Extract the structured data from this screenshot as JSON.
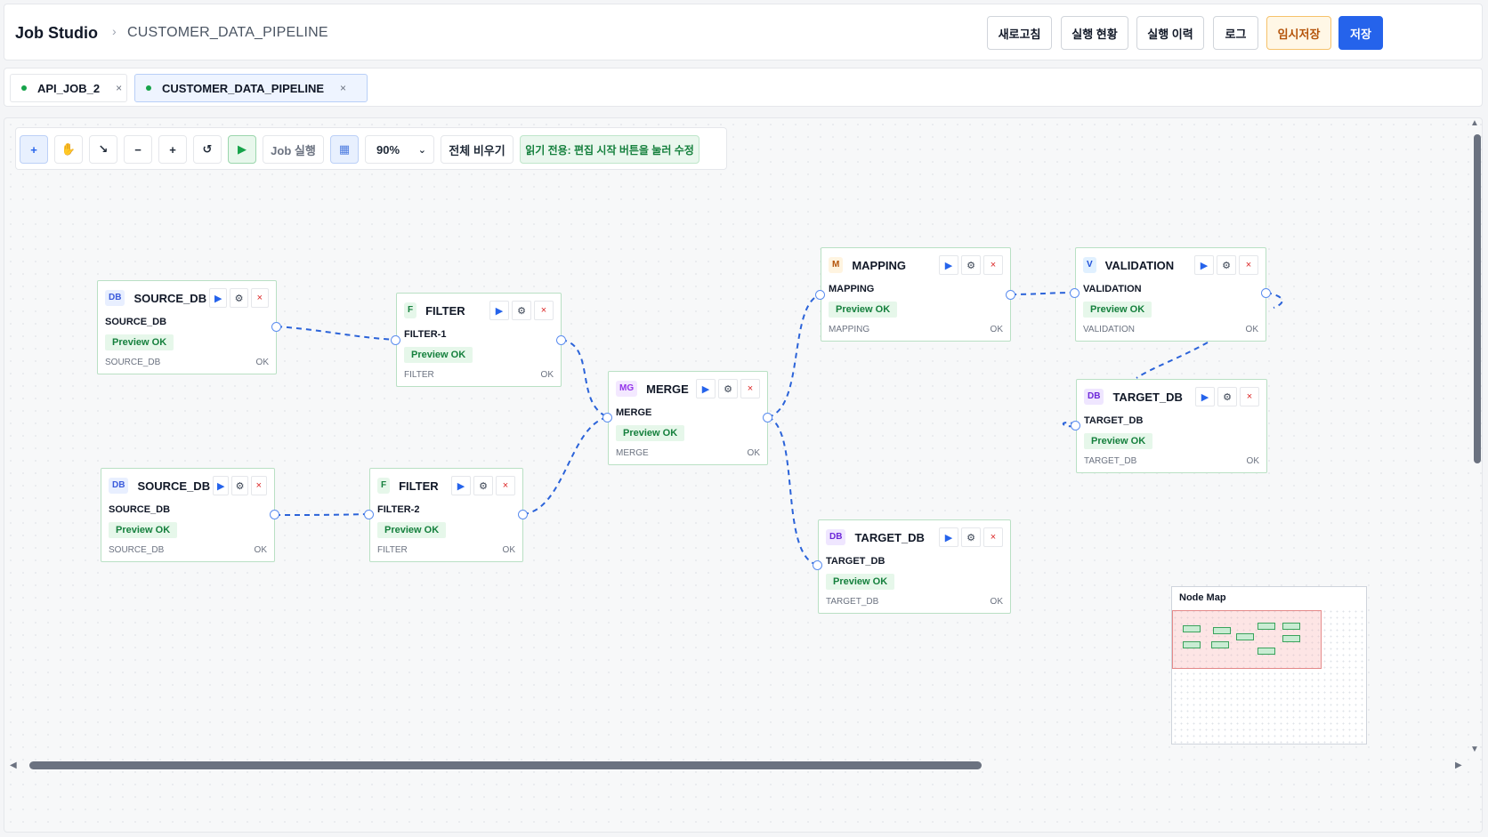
{
  "header": {
    "app_title": "Job Studio",
    "separator": "›",
    "current_job": "CUSTOMER_DATA_PIPELINE",
    "buttons": {
      "refresh": "새로고침",
      "exec_status": "실행 현황",
      "exec_history": "실행 이력",
      "log": "로그",
      "temp_save": "임시저장",
      "save": "저장"
    }
  },
  "tabs": [
    {
      "label": "API_JOB_2",
      "close": "×"
    },
    {
      "label": "CUSTOMER_DATA_PIPELINE",
      "close": "×"
    }
  ],
  "toolbar": {
    "select_icon": "+",
    "hand_icon": "✋",
    "edge_icon": "↘",
    "zoom_out": "−",
    "zoom_in": "+",
    "reset": "↺",
    "run_icon": "▶",
    "job_run": "Job 실행",
    "grid_icon": "▦",
    "zoom_level": "90%",
    "clear_all": "전체 비우기",
    "readonly_note": "읽기 전용: 편집 시작 버튼을 눌러 수정"
  },
  "nodes": [
    {
      "id": "source1",
      "badge": "DB",
      "title": "SOURCE_DB",
      "sub": "SOURCE_DB",
      "preview": "Preview OK",
      "type": "SOURCE_DB",
      "status": "OK"
    },
    {
      "id": "filter1",
      "badge": "F",
      "title": "FILTER",
      "sub": "FILTER-1",
      "preview": "Preview OK",
      "type": "FILTER",
      "status": "OK"
    },
    {
      "id": "source2",
      "badge": "DB",
      "title": "SOURCE_DB",
      "sub": "SOURCE_DB",
      "preview": "Preview OK",
      "type": "SOURCE_DB",
      "status": "OK"
    },
    {
      "id": "filter2",
      "badge": "F",
      "title": "FILTER",
      "sub": "FILTER-2",
      "preview": "Preview OK",
      "type": "FILTER",
      "status": "OK"
    },
    {
      "id": "merge",
      "badge": "MG",
      "title": "MERGE",
      "sub": "MERGE",
      "preview": "Preview OK",
      "type": "MERGE",
      "status": "OK"
    },
    {
      "id": "mapping",
      "badge": "M",
      "title": "MAPPING",
      "sub": "MAPPING",
      "preview": "Preview OK",
      "type": "MAPPING",
      "status": "OK"
    },
    {
      "id": "validation",
      "badge": "V",
      "title": "VALIDATION",
      "sub": "VALIDATION",
      "preview": "Preview OK",
      "type": "VALIDATION",
      "status": "OK"
    },
    {
      "id": "target1",
      "badge": "DB",
      "title": "TARGET_DB",
      "sub": "TARGET_DB",
      "preview": "Preview OK",
      "type": "TARGET_DB",
      "status": "OK"
    },
    {
      "id": "target2",
      "badge": "DB",
      "title": "TARGET_DB",
      "sub": "TARGET_DB",
      "preview": "Preview OK",
      "type": "TARGET_DB",
      "status": "OK"
    }
  ],
  "node_actions": {
    "run": "▶",
    "settings": "⚙",
    "delete": "×"
  },
  "minimap": {
    "title": "Node Map"
  },
  "colors": {
    "accent": "#2563eb",
    "ok": "#15803d",
    "edge": "#2b63d9",
    "node_border": "#b9e0c4"
  }
}
